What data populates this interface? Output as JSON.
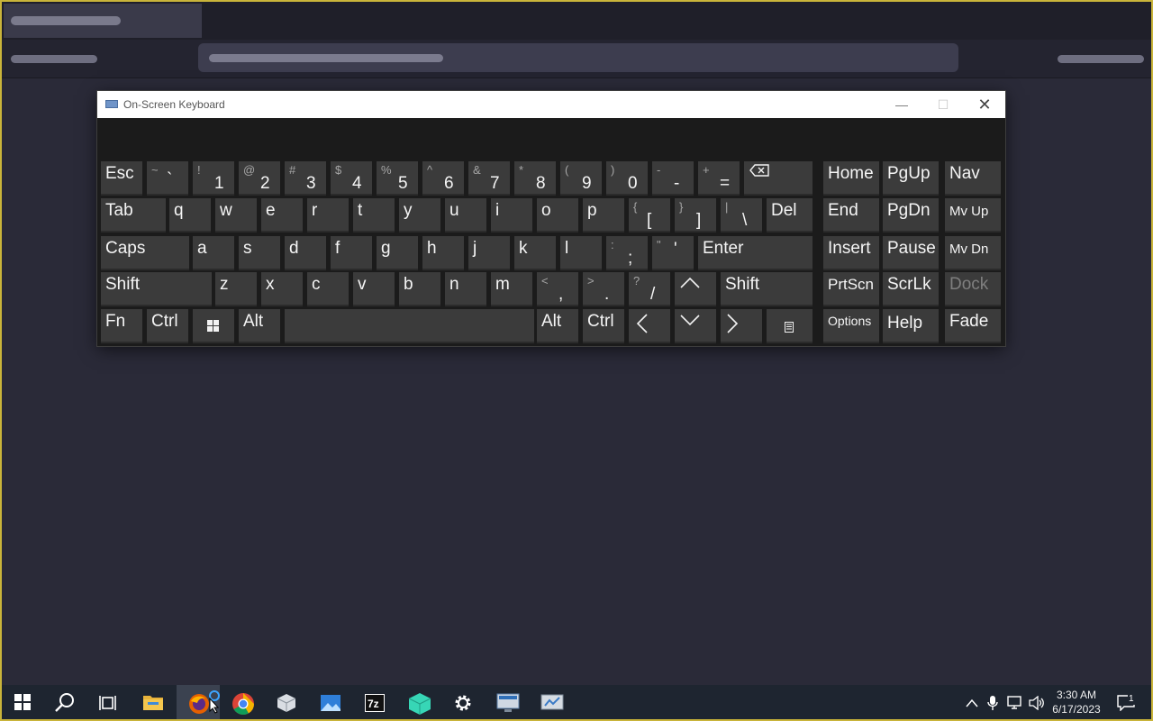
{
  "window": {
    "title": "On-Screen Keyboard",
    "min_glyph": "—",
    "max_glyph": "☐",
    "close_glyph": "✕"
  },
  "keys": {
    "esc": "Esc",
    "tab": "Tab",
    "caps": "Caps",
    "shift_left": "Shift",
    "shift_right": "Shift",
    "fn": "Fn",
    "ctrl_left": "Ctrl",
    "ctrl_right": "Ctrl",
    "alt_left": "Alt",
    "alt_right": "Alt",
    "del": "Del",
    "enter": "Enter",
    "home": "Home",
    "pgup": "PgUp",
    "nav": "Nav",
    "end": "End",
    "pgdn": "PgDn",
    "mvup": "Mv Up",
    "insert": "Insert",
    "pause": "Pause",
    "mvdn": "Mv Dn",
    "prtscn": "PrtScn",
    "scrlk": "ScrLk",
    "dock": "Dock",
    "options": "Options",
    "help": "Help",
    "fade": "Fade",
    "backtick": {
      "sec": "~",
      "pri": "`"
    },
    "n1": {
      "sec": "!",
      "pri": "1"
    },
    "n2": {
      "sec": "@",
      "pri": "2"
    },
    "n3": {
      "sec": "#",
      "pri": "3"
    },
    "n4": {
      "sec": "$",
      "pri": "4"
    },
    "n5": {
      "sec": "%",
      "pri": "5"
    },
    "n6": {
      "sec": "^",
      "pri": "6"
    },
    "n7": {
      "sec": "&",
      "pri": "7"
    },
    "n8": {
      "sec": "*",
      "pri": "8"
    },
    "n9": {
      "sec": "(",
      "pri": "9"
    },
    "n0": {
      "sec": ")",
      "pri": "0"
    },
    "minus": {
      "sec": "-",
      "pri": "-"
    },
    "equals": {
      "sec": "+",
      "pri": "="
    },
    "lbracket": {
      "sec": "{",
      "pri": "["
    },
    "rbracket": {
      "sec": "}",
      "pri": "]"
    },
    "backslash": {
      "sec": "|",
      "pri": "\\"
    },
    "semicolon": {
      "sec": ":",
      "pri": ";"
    },
    "quote": {
      "sec": "\"",
      "pri": "'"
    },
    "comma": {
      "sec": "<",
      "pri": ","
    },
    "period": {
      "sec": ">",
      "pri": "."
    },
    "slash": {
      "sec": "?",
      "pri": "/"
    },
    "q": "q",
    "w": "w",
    "e": "e",
    "r": "r",
    "t": "t",
    "y": "y",
    "u": "u",
    "i": "i",
    "o": "o",
    "p": "p",
    "a": "a",
    "s": "s",
    "d": "d",
    "f": "f",
    "g": "g",
    "h": "h",
    "j": "j",
    "k": "k",
    "l": "l",
    "z": "z",
    "x": "x",
    "c": "c",
    "v": "v",
    "b": "b",
    "n": "n",
    "m": "m"
  },
  "taskbar": {
    "time": "3:30 AM",
    "date": "6/17/2023",
    "notification_count": "1",
    "pinned": [
      "start-icon",
      "search-icon",
      "task-view-icon",
      "file-explorer-icon",
      "firefox-icon",
      "chrome-icon",
      "box-app-icon",
      "photos-icon",
      "7zip-icon",
      "cube-app-icon",
      "settings-icon",
      "remote-desktop-icon",
      "network-app-icon"
    ]
  },
  "colors": {
    "desktop": "#2a2a38",
    "key": "#3b3b3b",
    "osk_bg": "#1b1b1b",
    "frame": "#c9b43a"
  }
}
